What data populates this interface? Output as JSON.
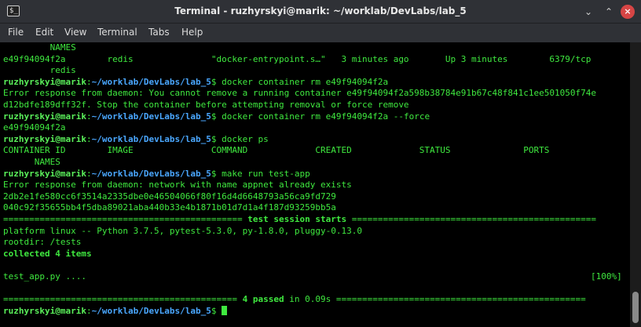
{
  "window": {
    "title": "Terminal - ruzhyrskyi@marik: ~/worklab/DevLabs/lab_5",
    "app_icon_glyph": "$_",
    "btn_min": "⌄",
    "btn_max": "⌃",
    "btn_close": "×"
  },
  "menu": [
    "File",
    "Edit",
    "View",
    "Terminal",
    "Tabs",
    "Help"
  ],
  "prompt": {
    "user": "ruzhyrskyi@marik",
    "path": "~/worklab/DevLabs/lab_5",
    "sep": ":",
    "dollar": "$ "
  },
  "lines": [
    "         NAMES",
    "e49f94094f2a        redis               \"docker-entrypoint.s…\"   3 minutes ago       Up 3 minutes        6379/tcp",
    "         redis",
    "docker container rm e49f94094f2a",
    "Error response from daemon: You cannot remove a running container e49f94094f2a598b38784e91b67c48f841c1ee501050f74e",
    "d12bdfe189dff32f. Stop the container before attempting removal or force remove",
    "docker container rm e49f94094f2a --force",
    "e49f94094f2a",
    "docker ps",
    "CONTAINER ID        IMAGE               COMMAND             CREATED             STATUS              PORTS",
    "      NAMES",
    "make run test-app",
    "Error response from daemon: network with name appnet already exists",
    "2db2e1fe580cc6f3514a2335dbe0e46504066f80f16d4d6648793a56ca9fd729",
    "040c92f35655bb4f5dba89021aba440b33e4b1871b01d7d1a4f187d93259bb5a",
    "============================== test session starts ==============================",
    "platform linux -- Python 3.7.5, pytest-5.3.0, py-1.8.0, pluggy-0.13.0",
    "rootdir: /tests",
    "collected 4 items",
    "",
    "test_app.py ....                                                                                   [100%]",
    "",
    "=============================== 4 passed in 0.09s ===============================",
    ""
  ],
  "session_rule_left": "============================================== ",
  "session_text": "test session starts",
  "session_rule_right": " ===============================================",
  "passed_rule_left": "============================================= ",
  "passed_text": "4 passed",
  "passed_time": " in 0.09s",
  "passed_rule_right": " ================================================",
  "test_line_left": "test_app.py ....",
  "test_line_right": "[100%]",
  "collected": "collected 4 items"
}
